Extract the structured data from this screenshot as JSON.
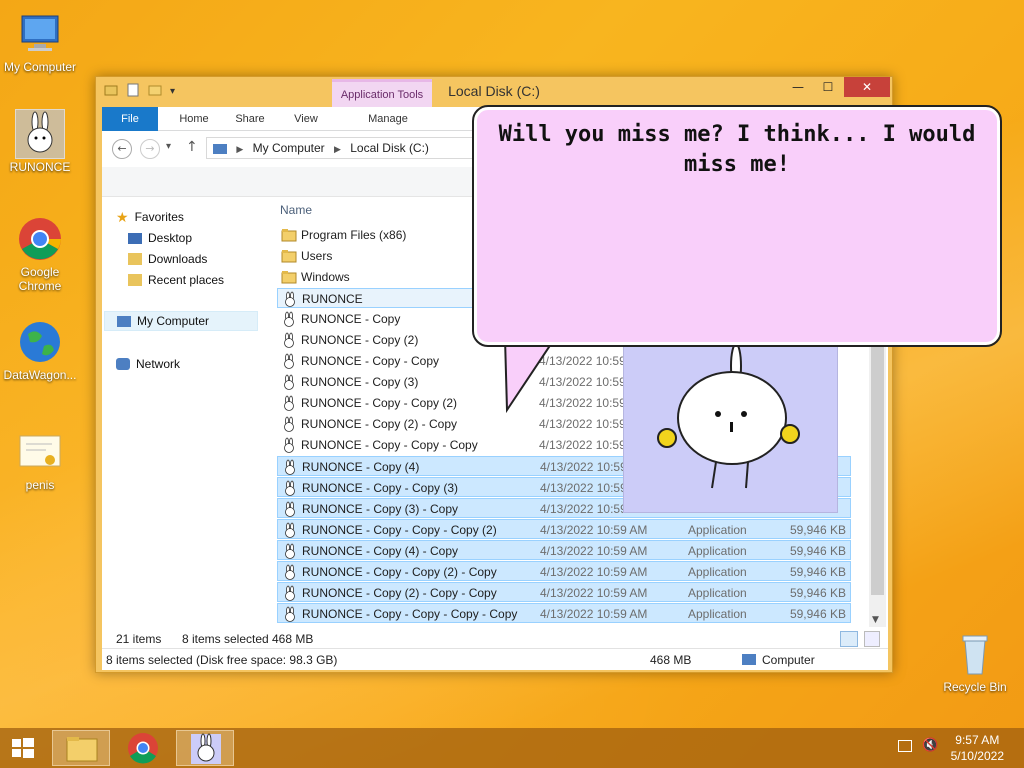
{
  "desktop": {
    "icons": [
      {
        "label": "My Computer"
      },
      {
        "label": "RUNONCE"
      },
      {
        "label": "Google Chrome"
      },
      {
        "label": "DataWagon..."
      },
      {
        "label": "penis"
      },
      {
        "label": "Recycle Bin"
      }
    ]
  },
  "window": {
    "title": "Local Disk (C:)",
    "contextual_tab_group": "Application Tools",
    "tabs": [
      {
        "label": "File"
      },
      {
        "label": "Home"
      },
      {
        "label": "Share"
      },
      {
        "label": "View"
      },
      {
        "label": "Manage"
      }
    ],
    "address": {
      "crumb1": "My Computer",
      "crumb2": "Local Disk (C:)"
    },
    "nav": {
      "favorites": "Favorites",
      "desktop": "Desktop",
      "downloads": "Downloads",
      "recent": "Recent places",
      "my_computer": "My Computer",
      "network": "Network"
    },
    "column_name": "Name",
    "files": [
      {
        "name": "Program Files (x86)",
        "date": "",
        "type": "",
        "size": "",
        "kind": "folder",
        "selected": false
      },
      {
        "name": "Users",
        "date": "",
        "type": "",
        "size": "",
        "kind": "folder",
        "selected": false
      },
      {
        "name": "Windows",
        "date": "",
        "type": "",
        "size": "",
        "kind": "folder",
        "selected": false
      },
      {
        "name": "RUNONCE",
        "date": "",
        "type": "",
        "size": "",
        "kind": "app",
        "selected": "focus"
      },
      {
        "name": "RUNONCE - Copy",
        "date": "",
        "type": "",
        "size": "",
        "kind": "app",
        "selected": false
      },
      {
        "name": "RUNONCE - Copy (2)",
        "date": "",
        "type": "",
        "size": "",
        "kind": "app",
        "selected": false
      },
      {
        "name": "RUNONCE - Copy - Copy",
        "date": "4/13/2022 10:59",
        "type": "",
        "size": "",
        "kind": "app",
        "selected": false
      },
      {
        "name": "RUNONCE - Copy (3)",
        "date": "4/13/2022 10:59",
        "type": "",
        "size": "",
        "kind": "app",
        "selected": false
      },
      {
        "name": "RUNONCE - Copy - Copy (2)",
        "date": "4/13/2022 10:59",
        "type": "",
        "size": "",
        "kind": "app",
        "selected": false
      },
      {
        "name": "RUNONCE - Copy (2) - Copy",
        "date": "4/13/2022 10:59",
        "type": "",
        "size": "",
        "kind": "app",
        "selected": false
      },
      {
        "name": "RUNONCE - Copy - Copy - Copy",
        "date": "4/13/2022 10:59",
        "type": "",
        "size": "",
        "kind": "app",
        "selected": false
      },
      {
        "name": "RUNONCE - Copy (4)",
        "date": "4/13/2022 10:59",
        "type": "",
        "size": "",
        "kind": "app",
        "selected": true
      },
      {
        "name": "RUNONCE - Copy - Copy (3)",
        "date": "4/13/2022 10:59",
        "type": "",
        "size": "",
        "kind": "app",
        "selected": true
      },
      {
        "name": "RUNONCE - Copy (3) - Copy",
        "date": "4/13/2022 10:59",
        "type": "",
        "size": "",
        "kind": "app",
        "selected": true
      },
      {
        "name": "RUNONCE - Copy - Copy - Copy (2)",
        "date": "4/13/2022 10:59 AM",
        "type": "Application",
        "size": "59,946 KB",
        "kind": "app",
        "selected": true
      },
      {
        "name": "RUNONCE - Copy (4) - Copy",
        "date": "4/13/2022 10:59 AM",
        "type": "Application",
        "size": "59,946 KB",
        "kind": "app",
        "selected": true
      },
      {
        "name": "RUNONCE - Copy - Copy (2) - Copy",
        "date": "4/13/2022 10:59 AM",
        "type": "Application",
        "size": "59,946 KB",
        "kind": "app",
        "selected": true
      },
      {
        "name": "RUNONCE - Copy (2) - Copy - Copy",
        "date": "4/13/2022 10:59 AM",
        "type": "Application",
        "size": "59,946 KB",
        "kind": "app",
        "selected": true
      },
      {
        "name": "RUNONCE - Copy - Copy - Copy - Copy",
        "date": "4/13/2022 10:59 AM",
        "type": "Application",
        "size": "59,946 KB",
        "kind": "app",
        "selected": true
      }
    ],
    "status_mid": {
      "items": "21 items",
      "selected": "8 items selected",
      "size": "468 MB"
    },
    "status_bottom": {
      "left": "8 items selected (Disk free space: 98.3 GB)",
      "size": "468 MB",
      "location": "Computer"
    }
  },
  "bubble": {
    "text": "Will you miss me? I think... I would miss me!"
  },
  "taskbar": {
    "time": "9:57 AM",
    "date": "5/10/2022"
  },
  "colors": {
    "accent": "#1979ca",
    "selection": "#cce8ff",
    "bubble": "#f9cffa",
    "panel": "#ccccf8"
  }
}
